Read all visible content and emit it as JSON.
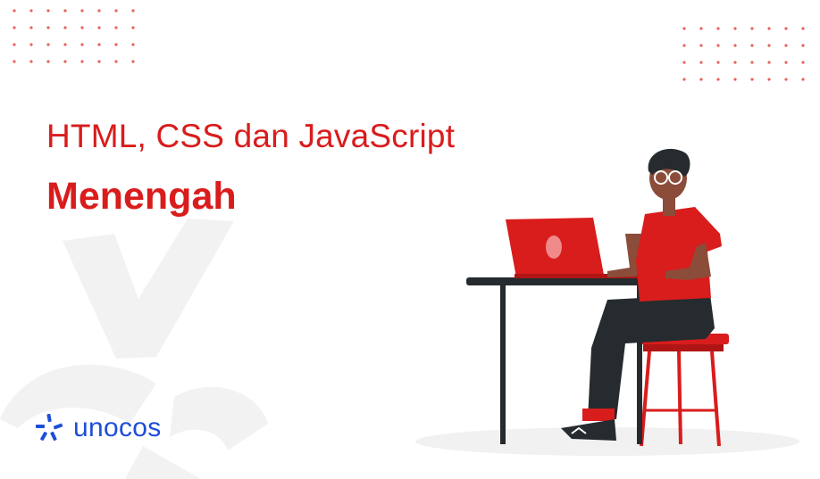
{
  "banner": {
    "title": "HTML, CSS dan JavaScript",
    "subtitle": "Menengah"
  },
  "brand": {
    "name": "unocos",
    "logo_icon": "unocos-spark-icon"
  },
  "illustration": {
    "subject": "person-working-on-laptop-icon"
  },
  "colors": {
    "accent_red": "#d91c1c",
    "brand_blue": "#1d4ed8",
    "dark": "#252b2e",
    "skin": "#8b4c3a",
    "bg_mark": "#f2f2f2",
    "dots": "#e8615a"
  }
}
